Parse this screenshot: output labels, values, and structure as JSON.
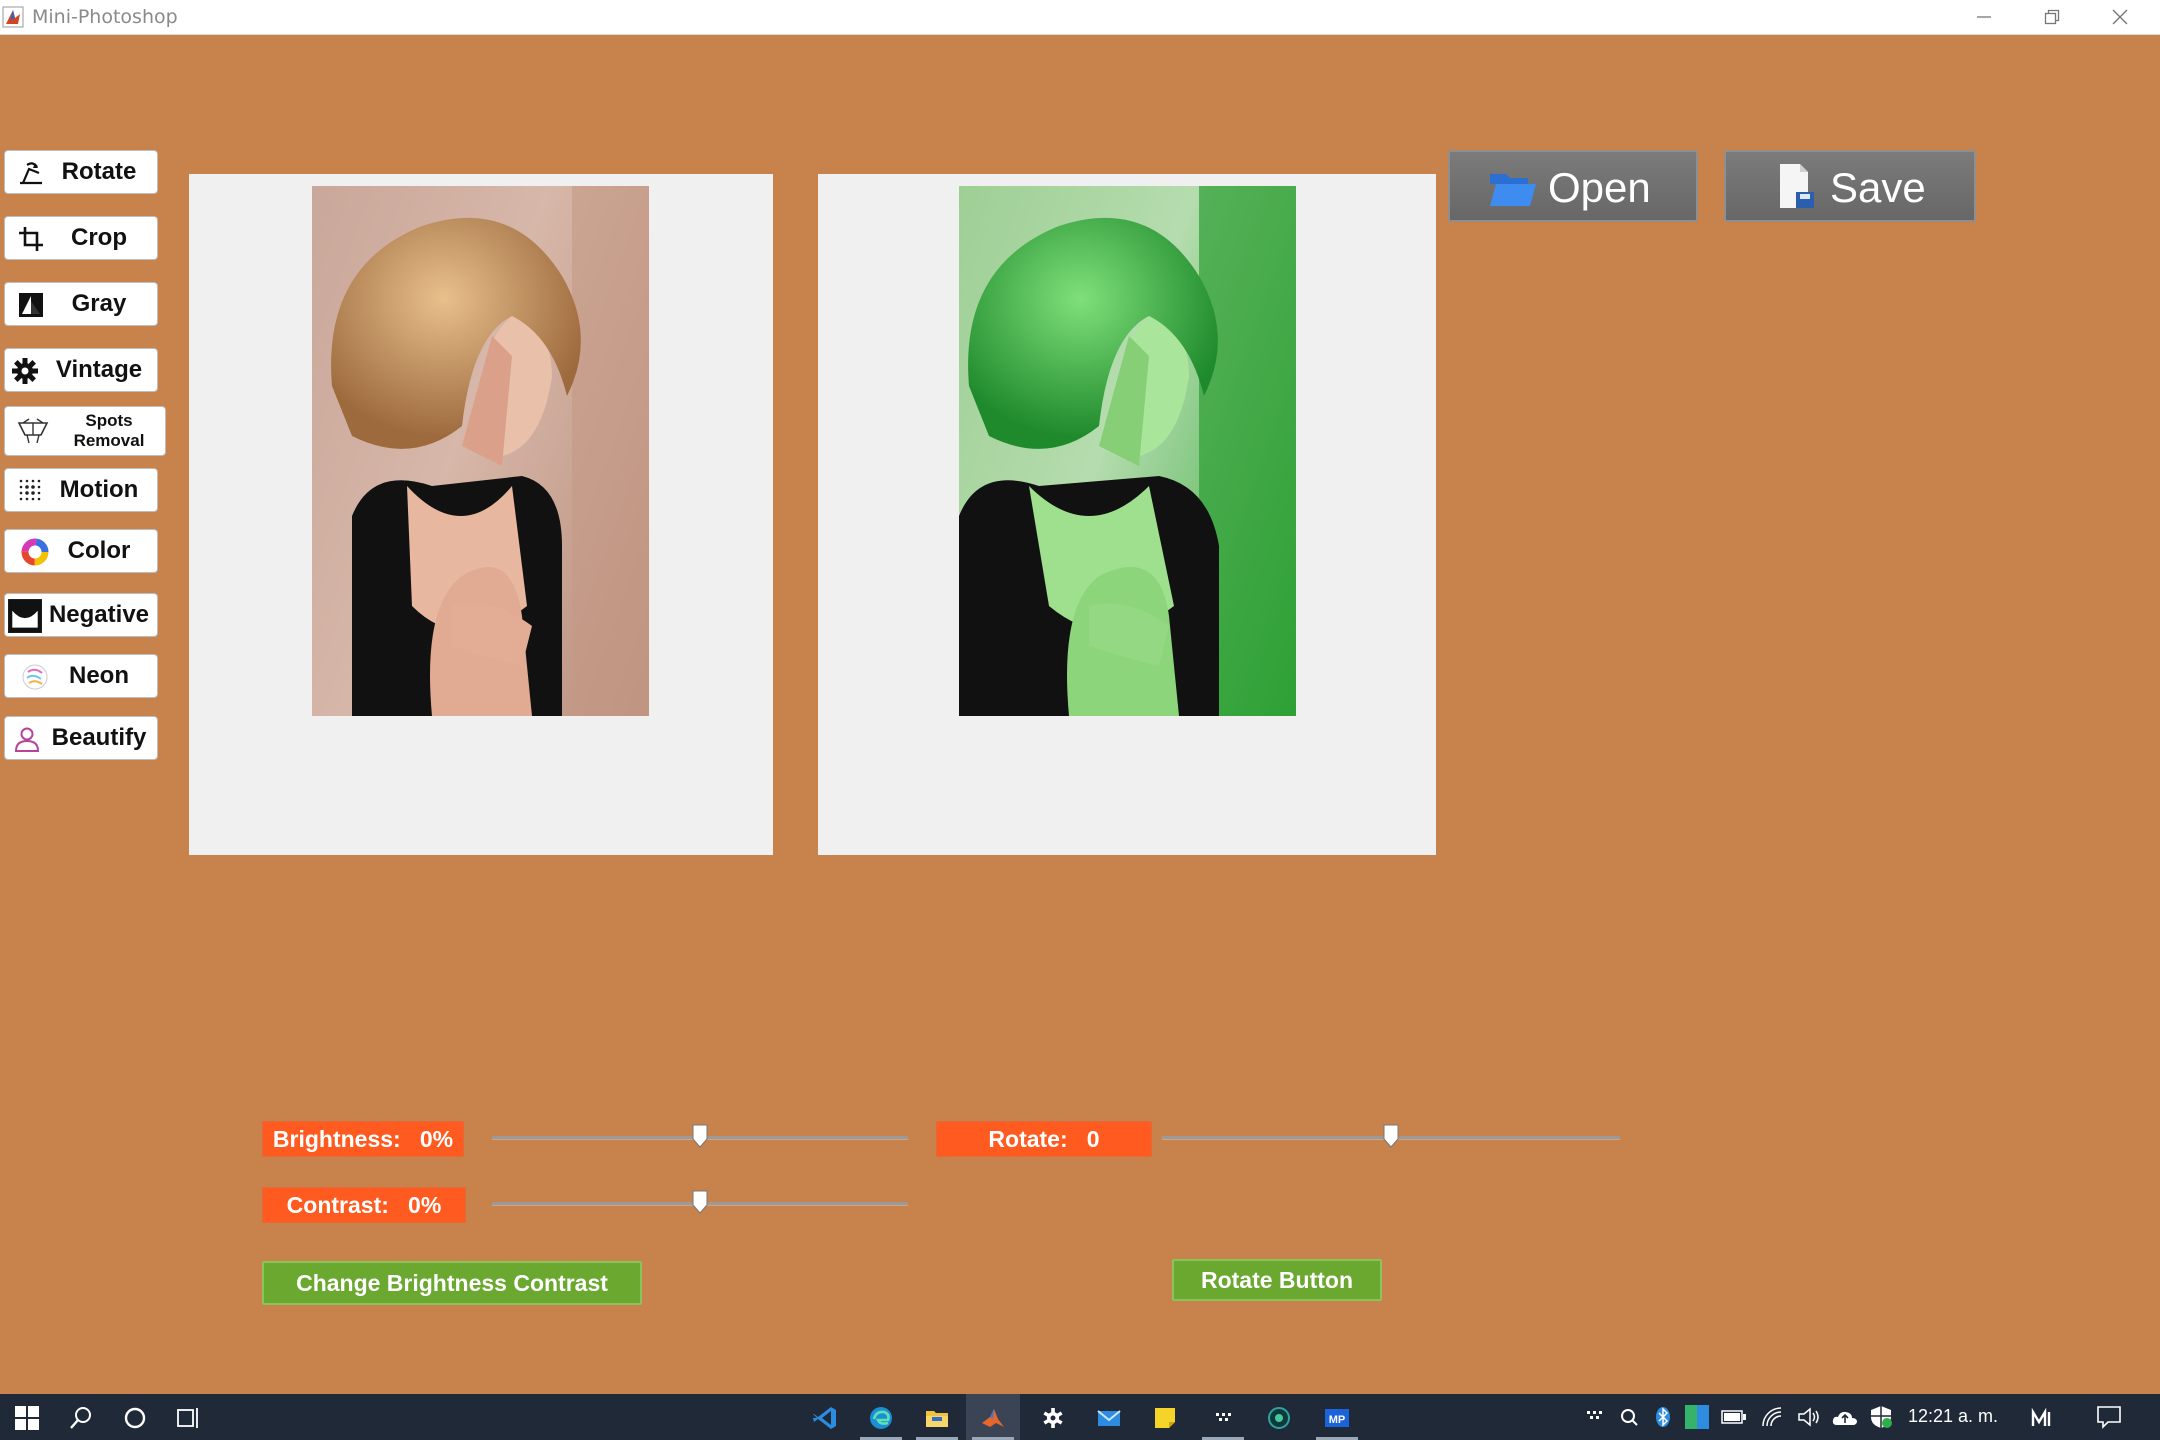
{
  "window": {
    "title": "Mini-Photoshop"
  },
  "tools": [
    {
      "id": "rotate",
      "label": "Rotate",
      "icon": "rotate-tool-icon"
    },
    {
      "id": "crop",
      "label": "Crop",
      "icon": "crop-icon"
    },
    {
      "id": "gray",
      "label": "Gray",
      "icon": "grayscale-icon"
    },
    {
      "id": "vintage",
      "label": "Vintage",
      "icon": "gear-icon"
    },
    {
      "id": "spots",
      "label": "Spots\nRemoval",
      "icon": "spots-removal-icon"
    },
    {
      "id": "motion",
      "label": "Motion",
      "icon": "motion-dots-icon"
    },
    {
      "id": "color",
      "label": "Color",
      "icon": "color-wheel-icon"
    },
    {
      "id": "negative",
      "label": "Negative",
      "icon": "negative-icon"
    },
    {
      "id": "neon",
      "label": "Neon",
      "icon": "neon-icon"
    },
    {
      "id": "beautify",
      "label": "Beautify",
      "icon": "person-icon"
    }
  ],
  "top_buttons": {
    "open_label": "Open",
    "save_label": "Save"
  },
  "controls": {
    "brightness_label": "Brightness:   0%",
    "contrast_label": "Contrast:   0%",
    "rotate_label": "Rotate:   0",
    "brightness_value": 0.5,
    "contrast_value": 0.5,
    "rotate_value": 0.5,
    "change_bc_button": "Change Brightness Contrast",
    "rotate_button": "Rotate Button"
  },
  "colors": {
    "background": "#c8824b",
    "label_orange": "#ff5a1f",
    "button_green": "#6aa82f",
    "button_gray": "#707070",
    "tint_green": "#2fbf3a"
  },
  "taskbar": {
    "clock": "12:21 a. m.",
    "pinned_icons": [
      "vscode-icon",
      "edge-icon",
      "file-explorer-icon",
      "matlab-icon",
      "settings-icon",
      "mail-icon",
      "sticky-notes-icon",
      "unknown-app-icon",
      "security-app-icon",
      "mp-app-icon"
    ],
    "tray_icons": [
      "tray-app-icon",
      "magnifier-icon",
      "bluetooth-icon",
      "tray-color-icon",
      "battery-icon",
      "wifi-icon",
      "volume-icon",
      "cloud-icon",
      "defender-icon",
      "ime-icon",
      "notifications-icon"
    ],
    "mp_badge": "MP"
  }
}
